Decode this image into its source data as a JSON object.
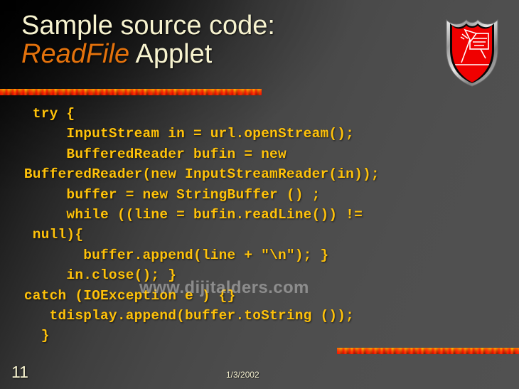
{
  "slide": {
    "background_color": "#4e4e4e",
    "title": {
      "line1": "Sample source code:",
      "line2_emphasis": "ReadFile",
      "line2_rest": " Applet",
      "color": "#f7f3cf",
      "emphasis_color": "#e4720c"
    },
    "code": {
      "color": "#ffc20a",
      "lines": [
        "  try {",
        "      InputStream in = url.openStream();",
        "      BufferedReader bufin = new",
        " BufferedReader(new InputStreamReader(in));",
        "      buffer = new StringBuffer () ;",
        "      while ((line = bufin.readLine()) !=",
        "  null){",
        "        buffer.append(line + \"\\n\"); }",
        "      in.close(); }",
        " catch (IOException e ) {}",
        "    tdisplay.append(buffer.toString ());",
        "   }"
      ]
    },
    "watermark": "www.dijitalders.com",
    "footer": {
      "slide_number": "11",
      "date": "1/3/2002"
    },
    "logo": {
      "name": "shield-logo",
      "shield_fill": "#f00000",
      "border_color": "#c9c9c9",
      "inner_border_color": "#080808"
    }
  }
}
